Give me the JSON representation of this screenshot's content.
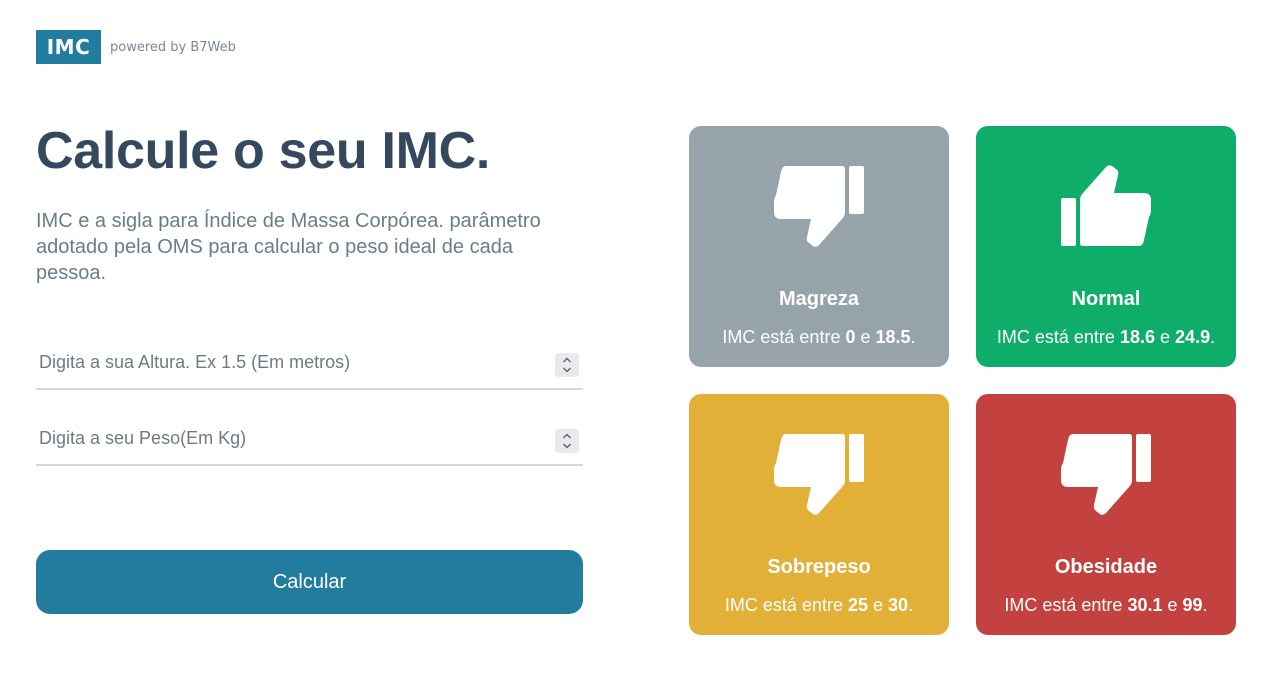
{
  "header": {
    "logo": "IMC",
    "powered": "powered by B7Web"
  },
  "main": {
    "title": "Calcule o seu IMC.",
    "description": "IMC e a sigla para Índice de Massa Corpórea. parâmetro adotado pela OMS para calcular o peso ideal de cada pessoa."
  },
  "form": {
    "height": {
      "value": "",
      "placeholder": "Digita a sua Altura. Ex 1.5 (Em metros)"
    },
    "weight": {
      "value": "",
      "placeholder": "Digita a seu Peso(Em Kg)"
    },
    "submit_label": "Calcular"
  },
  "levels": [
    {
      "title": "Magreza",
      "prefix": "IMC está entre",
      "min": "0",
      "sep": "e",
      "max": "18.5",
      "suffix": ".",
      "icon": "thumbs-down-icon",
      "color": "#96a3ab"
    },
    {
      "title": "Normal",
      "prefix": "IMC está entre",
      "min": "18.6",
      "sep": "e",
      "max": "24.9",
      "suffix": ".",
      "icon": "thumbs-up-icon",
      "color": "#0ead69"
    },
    {
      "title": "Sobrepeso",
      "prefix": "IMC está entre",
      "min": "25",
      "sep": "e",
      "max": "30",
      "suffix": ".",
      "icon": "thumbs-down-icon",
      "color": "#e2b036"
    },
    {
      "title": "Obesidade",
      "prefix": "IMC está entre",
      "min": "30.1",
      "sep": "e",
      "max": "99",
      "suffix": ".",
      "icon": "thumbs-down-icon",
      "color": "#c3423f"
    }
  ],
  "colors": {
    "primary": "#227c9e",
    "heading": "#34495e"
  }
}
